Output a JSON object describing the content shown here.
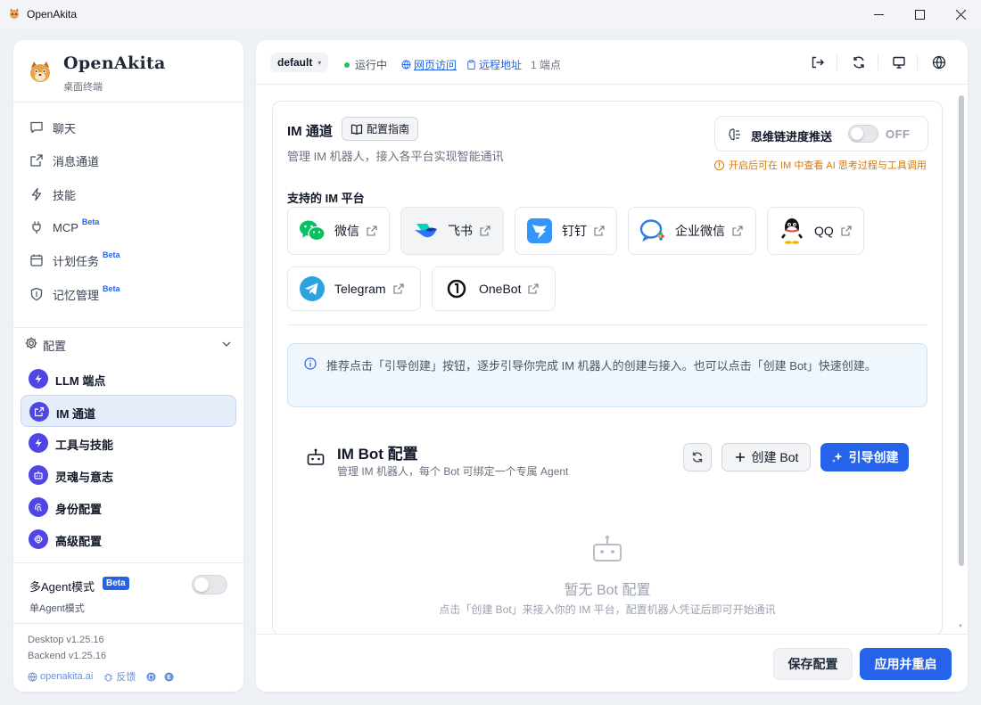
{
  "window": {
    "title": "OpenAkita"
  },
  "brand": {
    "name": "OpenAkita",
    "subtitle": "桌面终端"
  },
  "nav": [
    {
      "label": "聊天",
      "icon": "chat-icon"
    },
    {
      "label": "消息通道",
      "icon": "share-icon"
    },
    {
      "label": "技能",
      "icon": "bolt-icon"
    },
    {
      "label": "MCP",
      "icon": "plug-icon",
      "badge": "Beta"
    },
    {
      "label": "计划任务",
      "icon": "calendar-icon",
      "badge": "Beta"
    },
    {
      "label": "记忆管理",
      "icon": "shield-icon",
      "badge": "Beta"
    }
  ],
  "config": {
    "label": "配置",
    "items": [
      {
        "label": "LLM 端点",
        "icon": "bolt-icon",
        "active": false
      },
      {
        "label": "IM 通道",
        "icon": "share-icon",
        "active": true
      },
      {
        "label": "工具与技能",
        "icon": "bolt-icon",
        "active": false
      },
      {
        "label": "灵魂与意志",
        "icon": "robot-icon",
        "active": false
      },
      {
        "label": "身份配置",
        "icon": "fingerprint-icon",
        "active": false
      },
      {
        "label": "高级配置",
        "icon": "gear-icon",
        "active": false
      }
    ]
  },
  "agent_mode": {
    "label": "多Agent模式",
    "badge": "Beta",
    "sub": "单Agent模式",
    "enabled": false
  },
  "versions": {
    "desktop": "Desktop v1.25.16",
    "backend": "Backend v1.25.16",
    "site": "openakita.ai",
    "feedback": "反馈"
  },
  "topbar": {
    "workspace": "default",
    "status": "运行中",
    "web_access": "网页访问",
    "remote": "远程地址",
    "endpoints": "1 端点"
  },
  "im": {
    "title": "IM 通道",
    "guide_btn": "配置指南",
    "desc": "管理 IM 机器人，接入各平台实现智能通讯",
    "cot_label": "思维链进度推送",
    "cot_state": "OFF",
    "cot_hint": "开启后可在 IM 中查看 AI 思考过程与工具调用",
    "platforms_title": "支持的 IM 平台",
    "platforms": [
      {
        "name": "微信",
        "icon": "wechat-icon",
        "color": "#07c160"
      },
      {
        "name": "飞书",
        "icon": "feishu-icon",
        "color": "#3370ff"
      },
      {
        "name": "钉钉",
        "icon": "dingtalk-icon",
        "color": "#3296fa"
      },
      {
        "name": "企业微信",
        "icon": "wecom-icon",
        "color": "#2b7de9"
      },
      {
        "name": "QQ",
        "icon": "qq-icon",
        "color": "#111111"
      },
      {
        "name": "Telegram",
        "icon": "telegram-icon",
        "color": "#2aa3df"
      },
      {
        "name": "OneBot",
        "icon": "onebot-icon",
        "color": "#111111"
      }
    ],
    "info": "推荐点击「引导创建」按钮，逐步引导你完成 IM 机器人的创建与接入。也可以点击「创建 Bot」快速创建。",
    "bot": {
      "title": "IM Bot 配置",
      "subtitle": "管理 IM 机器人，每个 Bot 可绑定一个专属 Agent",
      "create": "创建 Bot",
      "wizard": "引导创建"
    },
    "empty": {
      "title": "暂无 Bot 配置",
      "sub": "点击「创建 Bot」来接入你的 IM 平台，配置机器人凭证后即可开始通讯"
    }
  },
  "footer": {
    "save": "保存配置",
    "apply": "应用并重启"
  },
  "colors": {
    "accent": "#2563eb",
    "status_ok": "#22c55e",
    "warning": "#d97706"
  }
}
